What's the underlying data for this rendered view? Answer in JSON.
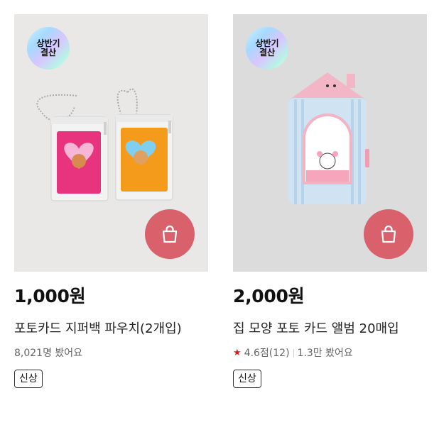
{
  "products": [
    {
      "badge": "상반기\n결산",
      "price": "1,000원",
      "title": "포토카드 지퍼백 파우치(2개입)",
      "views": "8,021명 봤어요",
      "tag": "신상",
      "cart_icon": "shopping-bag-icon"
    },
    {
      "badge": "상반기\n결산",
      "price": "2,000원",
      "title": "집 모양 포토 카드 앨범 20매입",
      "rating": "4.6점(12)",
      "views": "1.3만 봤어요",
      "tag": "신상",
      "cart_icon": "shopping-bag-icon"
    }
  ],
  "colors": {
    "cart_button": "#d9616b",
    "star": "#e4161b"
  }
}
